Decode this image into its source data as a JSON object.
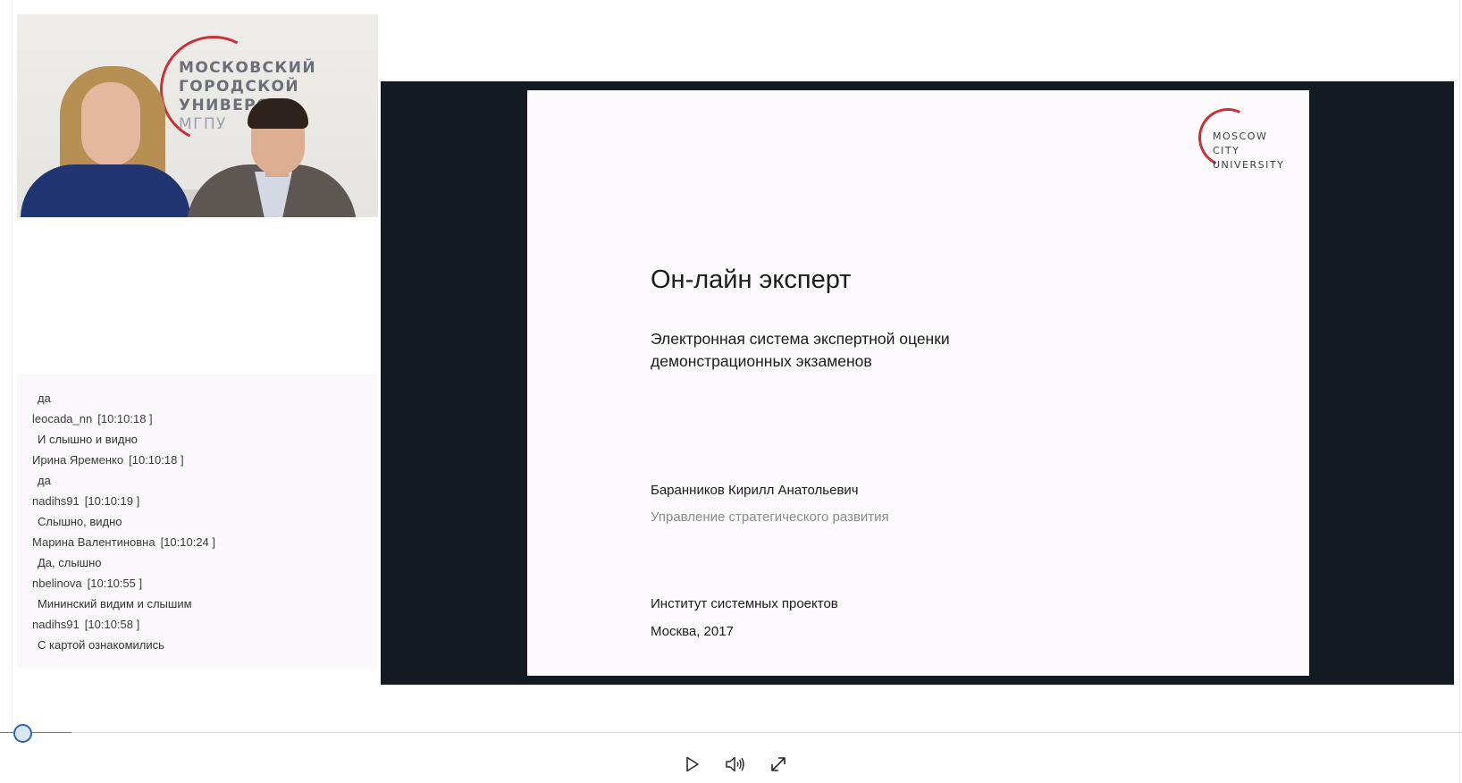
{
  "webcam": {
    "wall_sign_lines": [
      "МОСКОВСКИЙ",
      "ГОРОДСКОЙ",
      "УНИВЕРС",
      "МГПУ"
    ]
  },
  "chat": {
    "lines": [
      {
        "kind": "msg",
        "text": "да"
      },
      {
        "kind": "meta",
        "user": "leocada_nn",
        "time": "[10:10:18 ]"
      },
      {
        "kind": "msg",
        "text": "И слышно и видно"
      },
      {
        "kind": "meta",
        "user": "Ирина Яременко",
        "time": "[10:10:18 ]"
      },
      {
        "kind": "msg",
        "text": "да"
      },
      {
        "kind": "meta",
        "user": "nadihs91",
        "time": "[10:10:19 ]"
      },
      {
        "kind": "msg",
        "text": "Слышно, видно"
      },
      {
        "kind": "meta",
        "user": "Марина Валентиновна",
        "time": "[10:10:24 ]"
      },
      {
        "kind": "msg",
        "text": "Да, слышно"
      },
      {
        "kind": "meta",
        "user": "nbelinova",
        "time": "[10:10:55 ]"
      },
      {
        "kind": "msg",
        "text": "Мининский видим и слышим"
      },
      {
        "kind": "meta",
        "user": "nadihs91",
        "time": "[10:10:58 ]"
      },
      {
        "kind": "msg",
        "text": "С картой ознакомились"
      }
    ]
  },
  "slide": {
    "logo_lines": [
      "MOSCOW",
      "CITY",
      "UNIVERSITY"
    ],
    "title": "Он-лайн эксперт",
    "subtitle_lines": [
      "Электронная система экспертной оценки",
      "демонстрационных экзаменов"
    ],
    "author": "Баранников Кирилл Анатольевич",
    "department": "Управление стратегического развития",
    "institute": "Институт системных проектов",
    "city_year": "Москва, 2017"
  },
  "player": {
    "progress_fraction": 0.0,
    "controls": [
      {
        "name": "play-button",
        "icon": "play-icon"
      },
      {
        "name": "volume-button",
        "icon": "speaker-icon"
      },
      {
        "name": "fullscreen-button",
        "icon": "expand-icon"
      }
    ],
    "colors": {
      "accent": "#2b67ad",
      "logo_red": "#c8313a",
      "slide_bg": "#fdfafd",
      "frame_bg": "#141a22"
    }
  }
}
